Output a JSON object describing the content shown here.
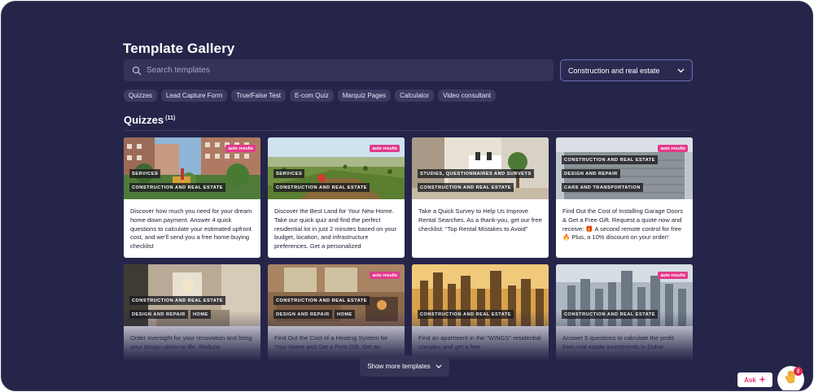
{
  "gallery": {
    "title": "Template Gallery",
    "search_placeholder": "Search templates",
    "category_select": "Construction and real estate"
  },
  "chips": [
    "Quizzes",
    "Lead Capture Form",
    "True/False Test",
    "E-com Quiz",
    "Marquiz Pages",
    "Calculator",
    "Video consultant"
  ],
  "section": {
    "title": "Quizzes",
    "count": "(11)"
  },
  "cards": [
    {
      "tags": [
        "SERVICES",
        "CONSTRUCTION AND REAL ESTATE"
      ],
      "auto": "auto results",
      "text": "Discover how much you need for your dream home down payment. Answer 4 quick questions to calculate your estimated upfront cost, and we'll send you a free home-buying checklist"
    },
    {
      "tags": [
        "SERVICES",
        "CONSTRUCTION AND REAL ESTATE"
      ],
      "auto": "auto results",
      "text": "Discover the Best Land for Your New Home. Take our quick quiz and find the perfect residential lot in just 2 minutes based on your budget, location, and infrastructure preferences. Get a personalized"
    },
    {
      "tags": [
        "STUDIES, QUESTIONNAIRES AND SURVEYS",
        "CONSTRUCTION AND REAL ESTATE"
      ],
      "auto": "",
      "text": "Take a Quick Survey to Help Us Improve Rental Searches. As a thank-you, get our free checklist: \"Top Rental Mistakes to Avoid\""
    },
    {
      "tags": [
        "CONSTRUCTION AND REAL ESTATE",
        "DESIGN AND REPAIR",
        "CARS AND TRANSPORTATION"
      ],
      "auto": "auto results",
      "text": "Find Out the Cost of Installing Garage Doors & Get a Free Gift. Request a quote now and receive: 🎁 A second remote control for free 🔥 Plus, a 10% discount on your order!"
    },
    {
      "tags": [
        "CONSTRUCTION AND REAL ESTATE",
        "DESIGN AND REPAIR",
        "HOME"
      ],
      "auto": "",
      "text": "Order oversight for your renovation and bring your design vision to life. Reduce"
    },
    {
      "tags": [
        "CONSTRUCTION AND REAL ESTATE",
        "DESIGN AND REPAIR",
        "HOME"
      ],
      "auto": "auto results",
      "text": "Find Out the Cost of a Heating System for Your Home and Get a Free Gift. Get an"
    },
    {
      "tags": [
        "CONSTRUCTION AND REAL ESTATE"
      ],
      "auto": "",
      "text": "Find an apartment in the \"WINGS\" residential complex and get a free"
    },
    {
      "tags": [
        "CONSTRUCTION AND REAL ESTATE"
      ],
      "auto": "auto results",
      "text": "Answer 5 questions to calculate the profit from real estate investments in Dubai"
    }
  ],
  "show_more": "Show more templates",
  "ask": {
    "label": "Ask",
    "badge": "2"
  },
  "colors": {
    "background": "#25254a",
    "accent_pink": "#e23a8c",
    "select_border": "#6e72b6"
  }
}
